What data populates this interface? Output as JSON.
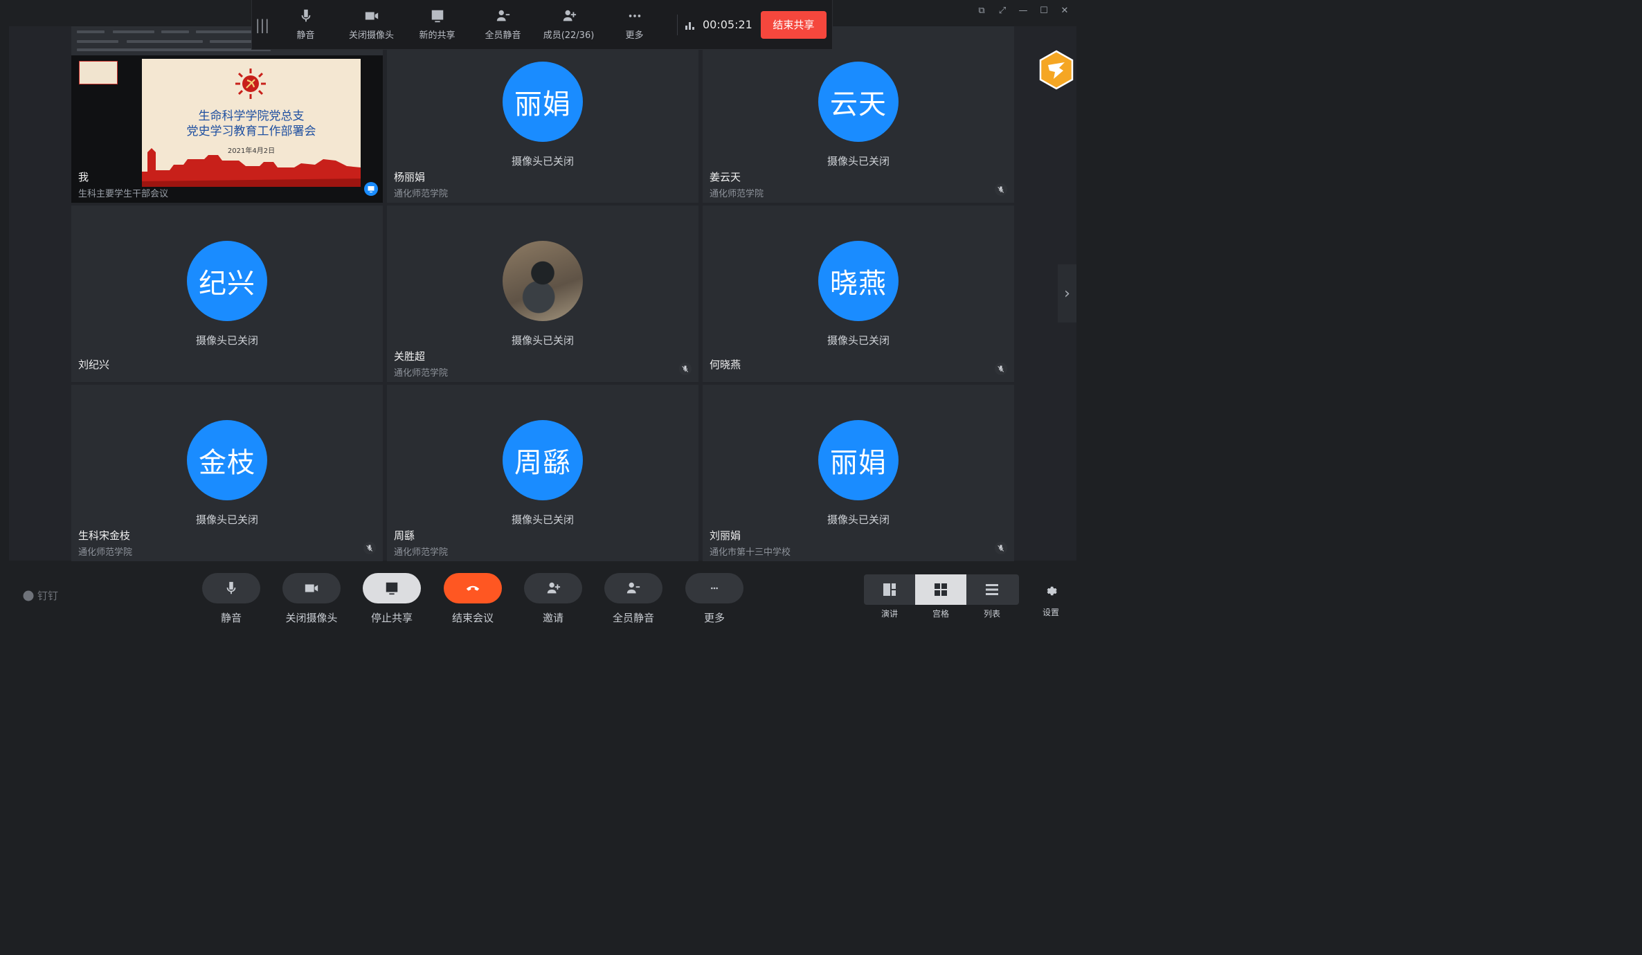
{
  "share_toolbar": {
    "buttons": [
      {
        "label": "静音",
        "icon": "mic-icon"
      },
      {
        "label": "关闭摄像头",
        "icon": "camera-icon"
      },
      {
        "label": "新的共享",
        "icon": "share-screen-icon"
      },
      {
        "label": "全员静音",
        "icon": "mute-all-icon"
      },
      {
        "label": "成员(22/36)",
        "icon": "members-icon"
      },
      {
        "label": "更多",
        "icon": "more-icon"
      }
    ],
    "timer": "00:05:21",
    "end_share_label": "结束共享"
  },
  "shared_screen": {
    "slide_title_line1": "生命科学学院党总支",
    "slide_title_line2": "党史学习教育工作部署会",
    "slide_date": "2021年4月2日",
    "participant_name": "我",
    "meeting_subtitle": "生科主要学生干部会议"
  },
  "participants": [
    {
      "avatar_text": "丽娟",
      "name": "杨丽娟",
      "org": "通化师范学院",
      "status": "摄像头已关闭",
      "muted": false
    },
    {
      "avatar_text": "云天",
      "name": "姜云天",
      "org": "通化师范学院",
      "status": "摄像头已关闭",
      "muted": true
    },
    {
      "avatar_text": "纪兴",
      "name": "刘纪兴",
      "org": "",
      "status": "摄像头已关闭",
      "muted": false
    },
    {
      "avatar_text": "",
      "name": "关胜超",
      "org": "通化师范学院",
      "status": "摄像头已关闭",
      "muted": true
    },
    {
      "avatar_text": "晓燕",
      "name": "何晓燕",
      "org": "",
      "status": "摄像头已关闭",
      "muted": true
    },
    {
      "avatar_text": "金枝",
      "name": "生科宋金枝",
      "org": "通化师范学院",
      "status": "摄像头已关闭",
      "muted": true
    },
    {
      "avatar_text": "周繇",
      "name": "周繇",
      "org": "通化师范学院",
      "status": "摄像头已关闭",
      "muted": false
    },
    {
      "avatar_text": "丽娟",
      "name": "刘丽娟",
      "org": "通化市第十三中学校",
      "status": "摄像头已关闭",
      "muted": true
    }
  ],
  "bottom_bar": {
    "brand": "钉钉",
    "buttons": [
      {
        "label": "静音",
        "icon": "mic-icon"
      },
      {
        "label": "关闭摄像头",
        "icon": "camera-icon"
      },
      {
        "label": "停止共享",
        "icon": "share-screen-icon"
      },
      {
        "label": "结束会议",
        "icon": "hangup-icon"
      },
      {
        "label": "邀请",
        "icon": "invite-icon"
      },
      {
        "label": "全员静音",
        "icon": "mute-all-icon"
      },
      {
        "label": "更多",
        "icon": "more-icon"
      }
    ],
    "layouts": [
      {
        "label": "演讲",
        "icon": "speaker-layout-icon"
      },
      {
        "label": "宫格",
        "icon": "grid-layout-icon"
      },
      {
        "label": "列表",
        "icon": "list-layout-icon"
      }
    ],
    "settings_label": "设置"
  },
  "colors": {
    "accent_blue": "#1a8cff",
    "end_share_red": "#f5473d",
    "hangup_orange": "#ff5722",
    "background": "#1e2023"
  }
}
